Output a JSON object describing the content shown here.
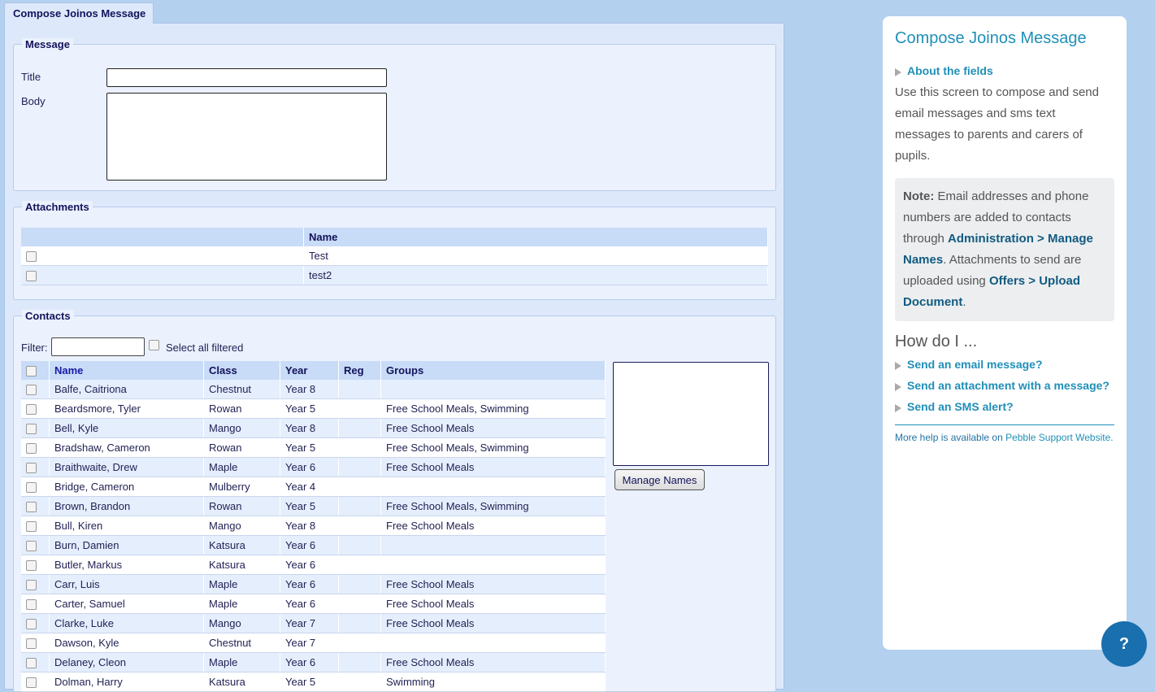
{
  "tab": {
    "label": "Compose Joinos Message"
  },
  "message": {
    "legend": "Message",
    "title_label": "Title",
    "title_value": "",
    "body_label": "Body",
    "body_value": ""
  },
  "attachments": {
    "legend": "Attachments",
    "column_name": "Name",
    "rows": [
      {
        "name": "Test"
      },
      {
        "name": "test2"
      }
    ]
  },
  "contacts": {
    "legend": "Contacts",
    "filter_label": "Filter:",
    "filter_value": "",
    "select_all_label": "Select all filtered",
    "columns": {
      "name": "Name",
      "class": "Class",
      "year": "Year",
      "reg": "Reg",
      "groups": "Groups"
    },
    "rows": [
      {
        "name": "Balfe, Caitriona",
        "class": "Chestnut",
        "year": "Year 8",
        "reg": "",
        "groups": ""
      },
      {
        "name": "Beardsmore, Tyler",
        "class": "Rowan",
        "year": "Year 5",
        "reg": "",
        "groups": "Free School Meals, Swimming"
      },
      {
        "name": "Bell, Kyle",
        "class": "Mango",
        "year": "Year 8",
        "reg": "",
        "groups": "Free School Meals"
      },
      {
        "name": "Bradshaw, Cameron",
        "class": "Rowan",
        "year": "Year 5",
        "reg": "",
        "groups": "Free School Meals, Swimming"
      },
      {
        "name": "Braithwaite, Drew",
        "class": "Maple",
        "year": "Year 6",
        "reg": "",
        "groups": "Free School Meals"
      },
      {
        "name": "Bridge, Cameron",
        "class": "Mulberry",
        "year": "Year 4",
        "reg": "",
        "groups": ""
      },
      {
        "name": "Brown, Brandon",
        "class": "Rowan",
        "year": "Year 5",
        "reg": "",
        "groups": "Free School Meals, Swimming"
      },
      {
        "name": "Bull, Kiren",
        "class": "Mango",
        "year": "Year 8",
        "reg": "",
        "groups": "Free School Meals"
      },
      {
        "name": "Burn, Damien",
        "class": "Katsura",
        "year": "Year 6",
        "reg": "",
        "groups": ""
      },
      {
        "name": "Butler, Markus",
        "class": "Katsura",
        "year": "Year 6",
        "reg": "",
        "groups": ""
      },
      {
        "name": "Carr, Luis",
        "class": "Maple",
        "year": "Year 6",
        "reg": "",
        "groups": "Free School Meals"
      },
      {
        "name": "Carter, Samuel",
        "class": "Maple",
        "year": "Year 6",
        "reg": "",
        "groups": "Free School Meals"
      },
      {
        "name": "Clarke, Luke",
        "class": "Mango",
        "year": "Year 7",
        "reg": "",
        "groups": "Free School Meals"
      },
      {
        "name": "Dawson, Kyle",
        "class": "Chestnut",
        "year": "Year 7",
        "reg": "",
        "groups": ""
      },
      {
        "name": "Delaney, Cleon",
        "class": "Maple",
        "year": "Year 6",
        "reg": "",
        "groups": "Free School Meals"
      },
      {
        "name": "Dolman, Harry",
        "class": "Katsura",
        "year": "Year 5",
        "reg": "",
        "groups": "Swimming"
      }
    ],
    "manage_names_label": "Manage Names"
  },
  "help": {
    "title": "Compose Joinos Message",
    "about_toggle": "About the fields",
    "intro": "Use this screen to compose and send email messages and sms text messages to parents and carers of pupils.",
    "note_label": "Note:",
    "note_text_1": " Email addresses and phone numbers are added to contacts through ",
    "note_link_1": "Administration > Manage Names",
    "note_text_2": ". Attachments to send are uploaded using ",
    "note_link_2": "Offers > Upload Document",
    "note_text_3": ".",
    "howdo_heading": "How do I ...",
    "howdo_items": [
      "Send an email message?",
      "Send an attachment with a message?",
      "Send an SMS alert?"
    ],
    "footer_text": "More help is available on ",
    "footer_link": "Pebble Support Website."
  },
  "help_button": {
    "label": "?"
  },
  "colors": {
    "background": "#b3d0ef",
    "accent": "#1f8fb8",
    "header_row": "#c8dbf7",
    "help_button": "#1a6fae"
  }
}
